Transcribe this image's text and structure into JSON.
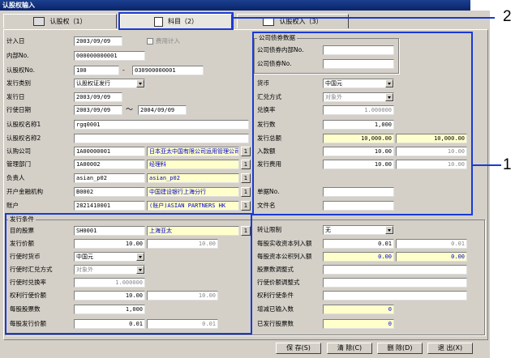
{
  "window": {
    "title": "认股权输入"
  },
  "tabs": [
    {
      "label": "认股权（1）"
    },
    {
      "label": "科目（2）"
    },
    {
      "label": "认股权入（3）"
    }
  ],
  "callouts": {
    "tab_callout": "2",
    "panel_callout": "1"
  },
  "top": {
    "input_date_label": "计入日",
    "input_date": "2003/09/09",
    "fee_checkbox_label": "费用计入",
    "internal_no_label": "内部No.",
    "internal_no": "000000000001",
    "warrant_no_label": "认股权No.",
    "warrant_no_a": "100",
    "warrant_no_b": "030900000001"
  },
  "company_bond": {
    "group_label": "公司债券数据",
    "internal_no_label": "公司债券内部No.",
    "internal_no": "",
    "bond_no_label": "公司债券No.",
    "bond_no": ""
  },
  "left": {
    "issue_type_label": "发行类别",
    "issue_type": "认股权证发行",
    "issue_date_label": "发行日",
    "issue_date": "2003/09/09",
    "exercise_period_label": "行使日期",
    "exercise_from": "2003/09/09",
    "tilde": "～",
    "exercise_to": "2004/09/09",
    "name1_label": "认股权名称1",
    "name1": "rgq0001",
    "name2_label": "认股权名称2",
    "name2": "",
    "subscribe_co_label": "认购公司",
    "subscribe_co_code": "1A00000001",
    "subscribe_co_name": "日本亚太中国有限公司运用管理公司",
    "manage_dept_label": "管理部门",
    "manage_dept_code": "1A00002",
    "manage_dept_name": "经理科",
    "person_label": "负责人",
    "person_code": "asian_p02",
    "person_name": "asian_p02",
    "bank_label": "开户金融机构",
    "bank_code": "B0002",
    "bank_name": "中国建设银行上海分行",
    "account_label": "账户",
    "account_code": "2821410001",
    "account_name": "(账户)ASIAN PARTNERS HK",
    "ref_btn": "1"
  },
  "right": {
    "currency_label": "货币",
    "currency": "中国元",
    "exchange_method_label": "汇兑方式",
    "exchange_method": "对象外",
    "rate_label": "兑换率",
    "rate": "1.000000",
    "issue_qty_label": "发行数",
    "issue_qty": "1,000",
    "issue_total_label": "发行总额",
    "issue_total_1": "10,000.00",
    "issue_total_2": "10,000.00",
    "deposit_label": "入款额",
    "deposit_1": "10.00",
    "deposit_2": "10.00",
    "issue_fee_label": "发行费用",
    "issue_fee_1": "10.00",
    "issue_fee_2": "10.00",
    "voucher_no_label": "单据No.",
    "voucher_no": "",
    "file_name_label": "文件名",
    "file_name": ""
  },
  "conditions": {
    "group_label": "发行条件",
    "target_stock_label": "目的股票",
    "target_stock_code": "SH0001",
    "target_stock_name": "上海亚太",
    "issue_price_label": "发行价额",
    "issue_price_1": "10.00",
    "issue_price_2": "10.00",
    "exercise_currency_label": "行使时货币",
    "exercise_currency": "中国元",
    "exercise_exchange_label": "行使时汇兑方式",
    "exercise_exchange": "对象外",
    "exercise_rate_label": "行使时兑换率",
    "exercise_rate": "1.000000",
    "exercise_price_label": "权利行使价额",
    "exercise_price_1": "10.00",
    "exercise_price_2": "10.00",
    "shares_per_label": "每股股票数",
    "shares_per": "1,000",
    "per_issue_price_label": "每股发行价额",
    "per_issue_price_1": "0.01",
    "per_issue_price_2": "0.01"
  },
  "conditions_right": {
    "transfer_limit_label": "转让限制",
    "transfer_limit": "无",
    "capital_label": "每股实收资本列入额",
    "capital_1": "0.01",
    "capital_2": "0.01",
    "reserve_label": "每股资本公积列入额",
    "reserve_1": "0.00",
    "reserve_2": "0.00",
    "adjust_label": "股票数调整式",
    "adjust": "",
    "price_adjust_label": "行使价额调整式",
    "price_adjust": "",
    "exercise_cond_label": "权利行使条件",
    "exercise_cond": "",
    "added_label": "增减已输入数",
    "added": "0",
    "issued_label": "已发行股票数",
    "issued": "0"
  },
  "buttons": {
    "save": "保 存(S)",
    "clear": "清 除(C)",
    "delete": "删 除(D)",
    "exit": "退 出(X)"
  }
}
